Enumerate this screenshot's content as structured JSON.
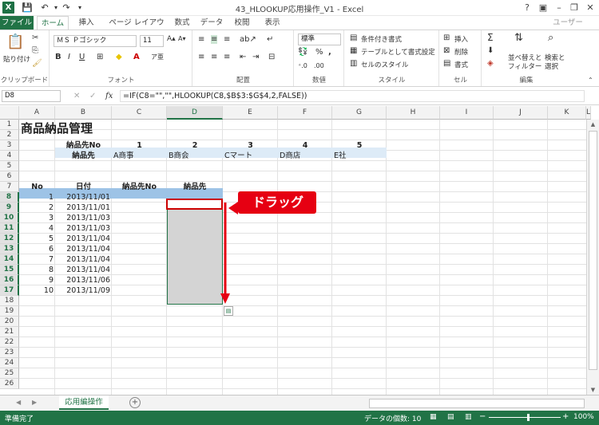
{
  "title_bar": {
    "title": "43_HLOOKUP応用操作_V1 - Excel",
    "user": "ユーザー"
  },
  "ribbon_tabs": [
    "ファイル",
    "ホーム",
    "挿入",
    "ページ レイアウト",
    "数式",
    "データ",
    "校閲",
    "表示"
  ],
  "ribbon": {
    "clipboard": {
      "paste": "貼り付け",
      "label": "クリップボード"
    },
    "font": {
      "name": "ＭＳ Ｐゴシック",
      "size": "11",
      "label": "フォント"
    },
    "alignment": {
      "label": "配置"
    },
    "number": {
      "format": "標準",
      "label": "数値"
    },
    "styles": {
      "cond": "条件付き書式",
      "table": "テーブルとして書式設定",
      "cell": "セルのスタイル",
      "label": "スタイル"
    },
    "cells": {
      "insert": "挿入",
      "delete": "削除",
      "format": "書式",
      "label": "セル"
    },
    "editing": {
      "sort": "並べ替えと",
      "sort2": "フィルター",
      "find": "検索と",
      "find2": "選択",
      "label": "編集"
    }
  },
  "formula_bar": {
    "name_box": "D8",
    "fx": "fx",
    "formula": "=IF(C8=\"\",\"\",HLOOKUP(C8,$B$3:$G$4,2,FALSE))"
  },
  "columns": [
    "A",
    "B",
    "C",
    "D",
    "E",
    "F",
    "G",
    "H",
    "I",
    "J",
    "K",
    "L"
  ],
  "rows": [
    "1",
    "2",
    "3",
    "4",
    "5",
    "6",
    "7",
    "8",
    "9",
    "10",
    "11",
    "12",
    "13",
    "14",
    "15",
    "16",
    "17",
    "18",
    "19",
    "20",
    "21",
    "22",
    "23",
    "24",
    "25",
    "26"
  ],
  "cells": {
    "title": "商品納品管理",
    "lookup_hdr1": "納品先No",
    "lookup_hdr2": "納品先",
    "lookup_nos": [
      "1",
      "2",
      "3",
      "4",
      "5"
    ],
    "lookup_names": [
      "A商事",
      "B商会",
      "Cマート",
      "D商店",
      "E社"
    ],
    "tbl_no": "No",
    "tbl_date": "日付",
    "tbl_destno": "納品先No",
    "tbl_dest": "納品先",
    "nos": [
      "1",
      "2",
      "3",
      "4",
      "5",
      "6",
      "7",
      "8",
      "9",
      "10"
    ],
    "dates": [
      "2013/11/01",
      "2013/11/01",
      "2013/11/03",
      "2013/11/03",
      "2013/11/04",
      "2013/11/04",
      "2013/11/04",
      "2013/11/04",
      "2013/11/06",
      "2013/11/09"
    ]
  },
  "callout": "ドラッグ",
  "sheet_tab": "応用編操作",
  "status": {
    "ready": "準備完了",
    "count": "データの個数: 10",
    "zoom": "100%"
  },
  "colors": {
    "accent": "#217346",
    "header_blue": "#9dc3e6",
    "light_blue": "#ddebf7",
    "callout_red": "#e60012"
  }
}
